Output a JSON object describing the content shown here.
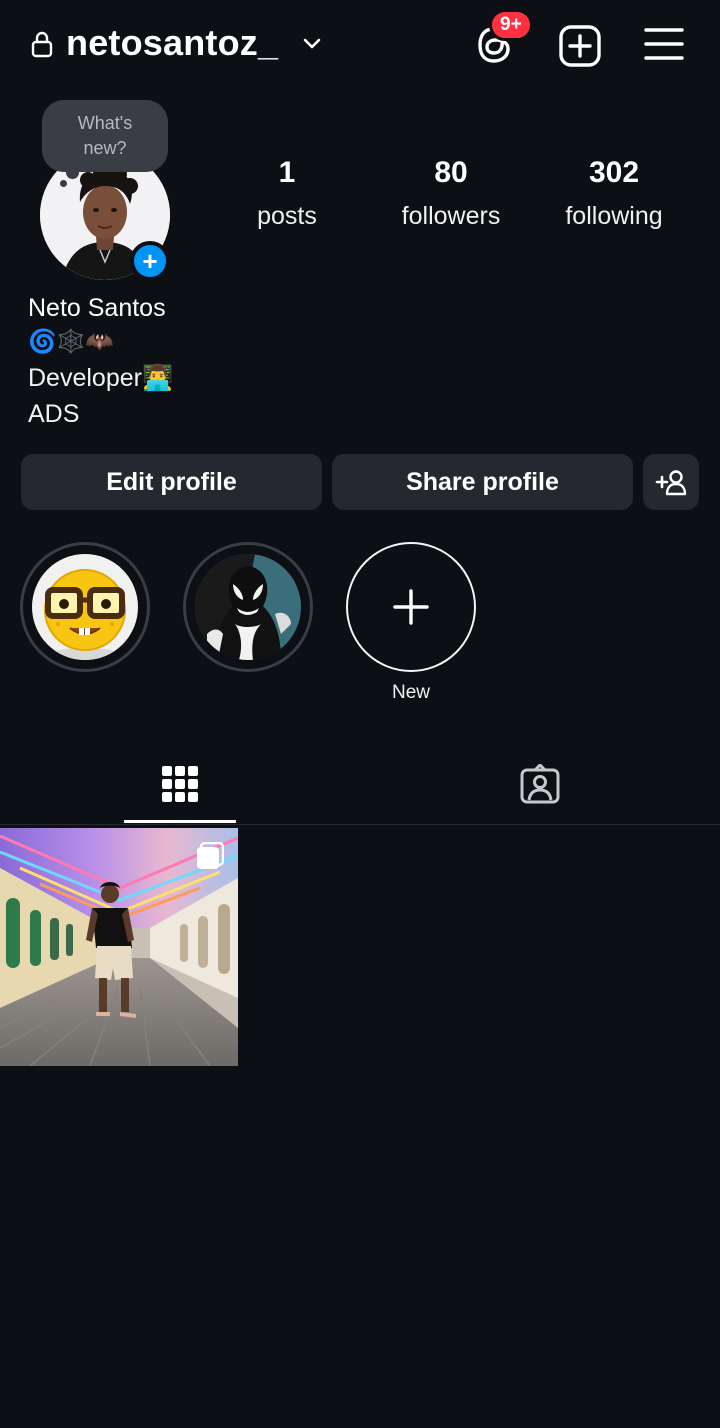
{
  "header": {
    "username": "netosantoz_",
    "notification_badge": "9+"
  },
  "profile": {
    "whats_new_bubble": "What's new?",
    "add_story_symbol": "+",
    "display_name": "Neto Santos",
    "bio_emojis": "🌀🕸️🦇",
    "bio_line_1": "Developer👨‍💻",
    "bio_line_2": "ADS"
  },
  "stats": {
    "posts": {
      "value": "1",
      "label": "posts"
    },
    "followers": {
      "value": "80",
      "label": "followers"
    },
    "following": {
      "value": "302",
      "label": "following"
    }
  },
  "actions": {
    "edit_profile": "Edit profile",
    "share_profile": "Share profile"
  },
  "highlights": {
    "items": [
      {
        "icon": "nerd-face-emoji-highlight"
      },
      {
        "icon": "venom-comic-highlight"
      }
    ],
    "new_label": "New"
  },
  "tabs": {
    "active": "grid",
    "items": [
      "grid-icon",
      "tagged-person-icon"
    ]
  },
  "posts": [
    {
      "subject": "person-in-colorful-street",
      "multi_photo": true
    }
  ],
  "colors": {
    "background": "#0c0f14",
    "button": "#25282e",
    "badge": "#ff3040",
    "accent_blue": "#0095f6"
  }
}
